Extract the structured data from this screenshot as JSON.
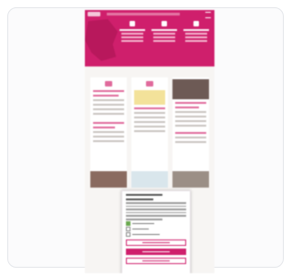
{
  "colors": {
    "brand": "#cf1f6c",
    "brand_dark": "#b8185c",
    "page_background": "#f7f5f3",
    "card_border": "#e4e6ea",
    "dialog_button": "#cf1f6c",
    "checkbox_on": "#6aa84f"
  },
  "page": {
    "header": {
      "logo": "logo-icon",
      "menu": "hamburger-menu-icon",
      "columns": [
        {
          "icon": "people-icon"
        },
        {
          "icon": "arrow-icon"
        },
        {
          "icon": "building-icon"
        }
      ]
    },
    "tiles": [
      {
        "icon": "calendar-icon"
      },
      {
        "icon": "news-icon"
      },
      {
        "icon": "photo-icon"
      }
    ],
    "cookie_dialog": {
      "options": [
        {
          "checked": true
        },
        {
          "checked": false
        },
        {
          "checked": false
        }
      ],
      "buttons": [
        {
          "style": "outline"
        },
        {
          "style": "filled"
        },
        {
          "style": "outline"
        }
      ]
    }
  }
}
